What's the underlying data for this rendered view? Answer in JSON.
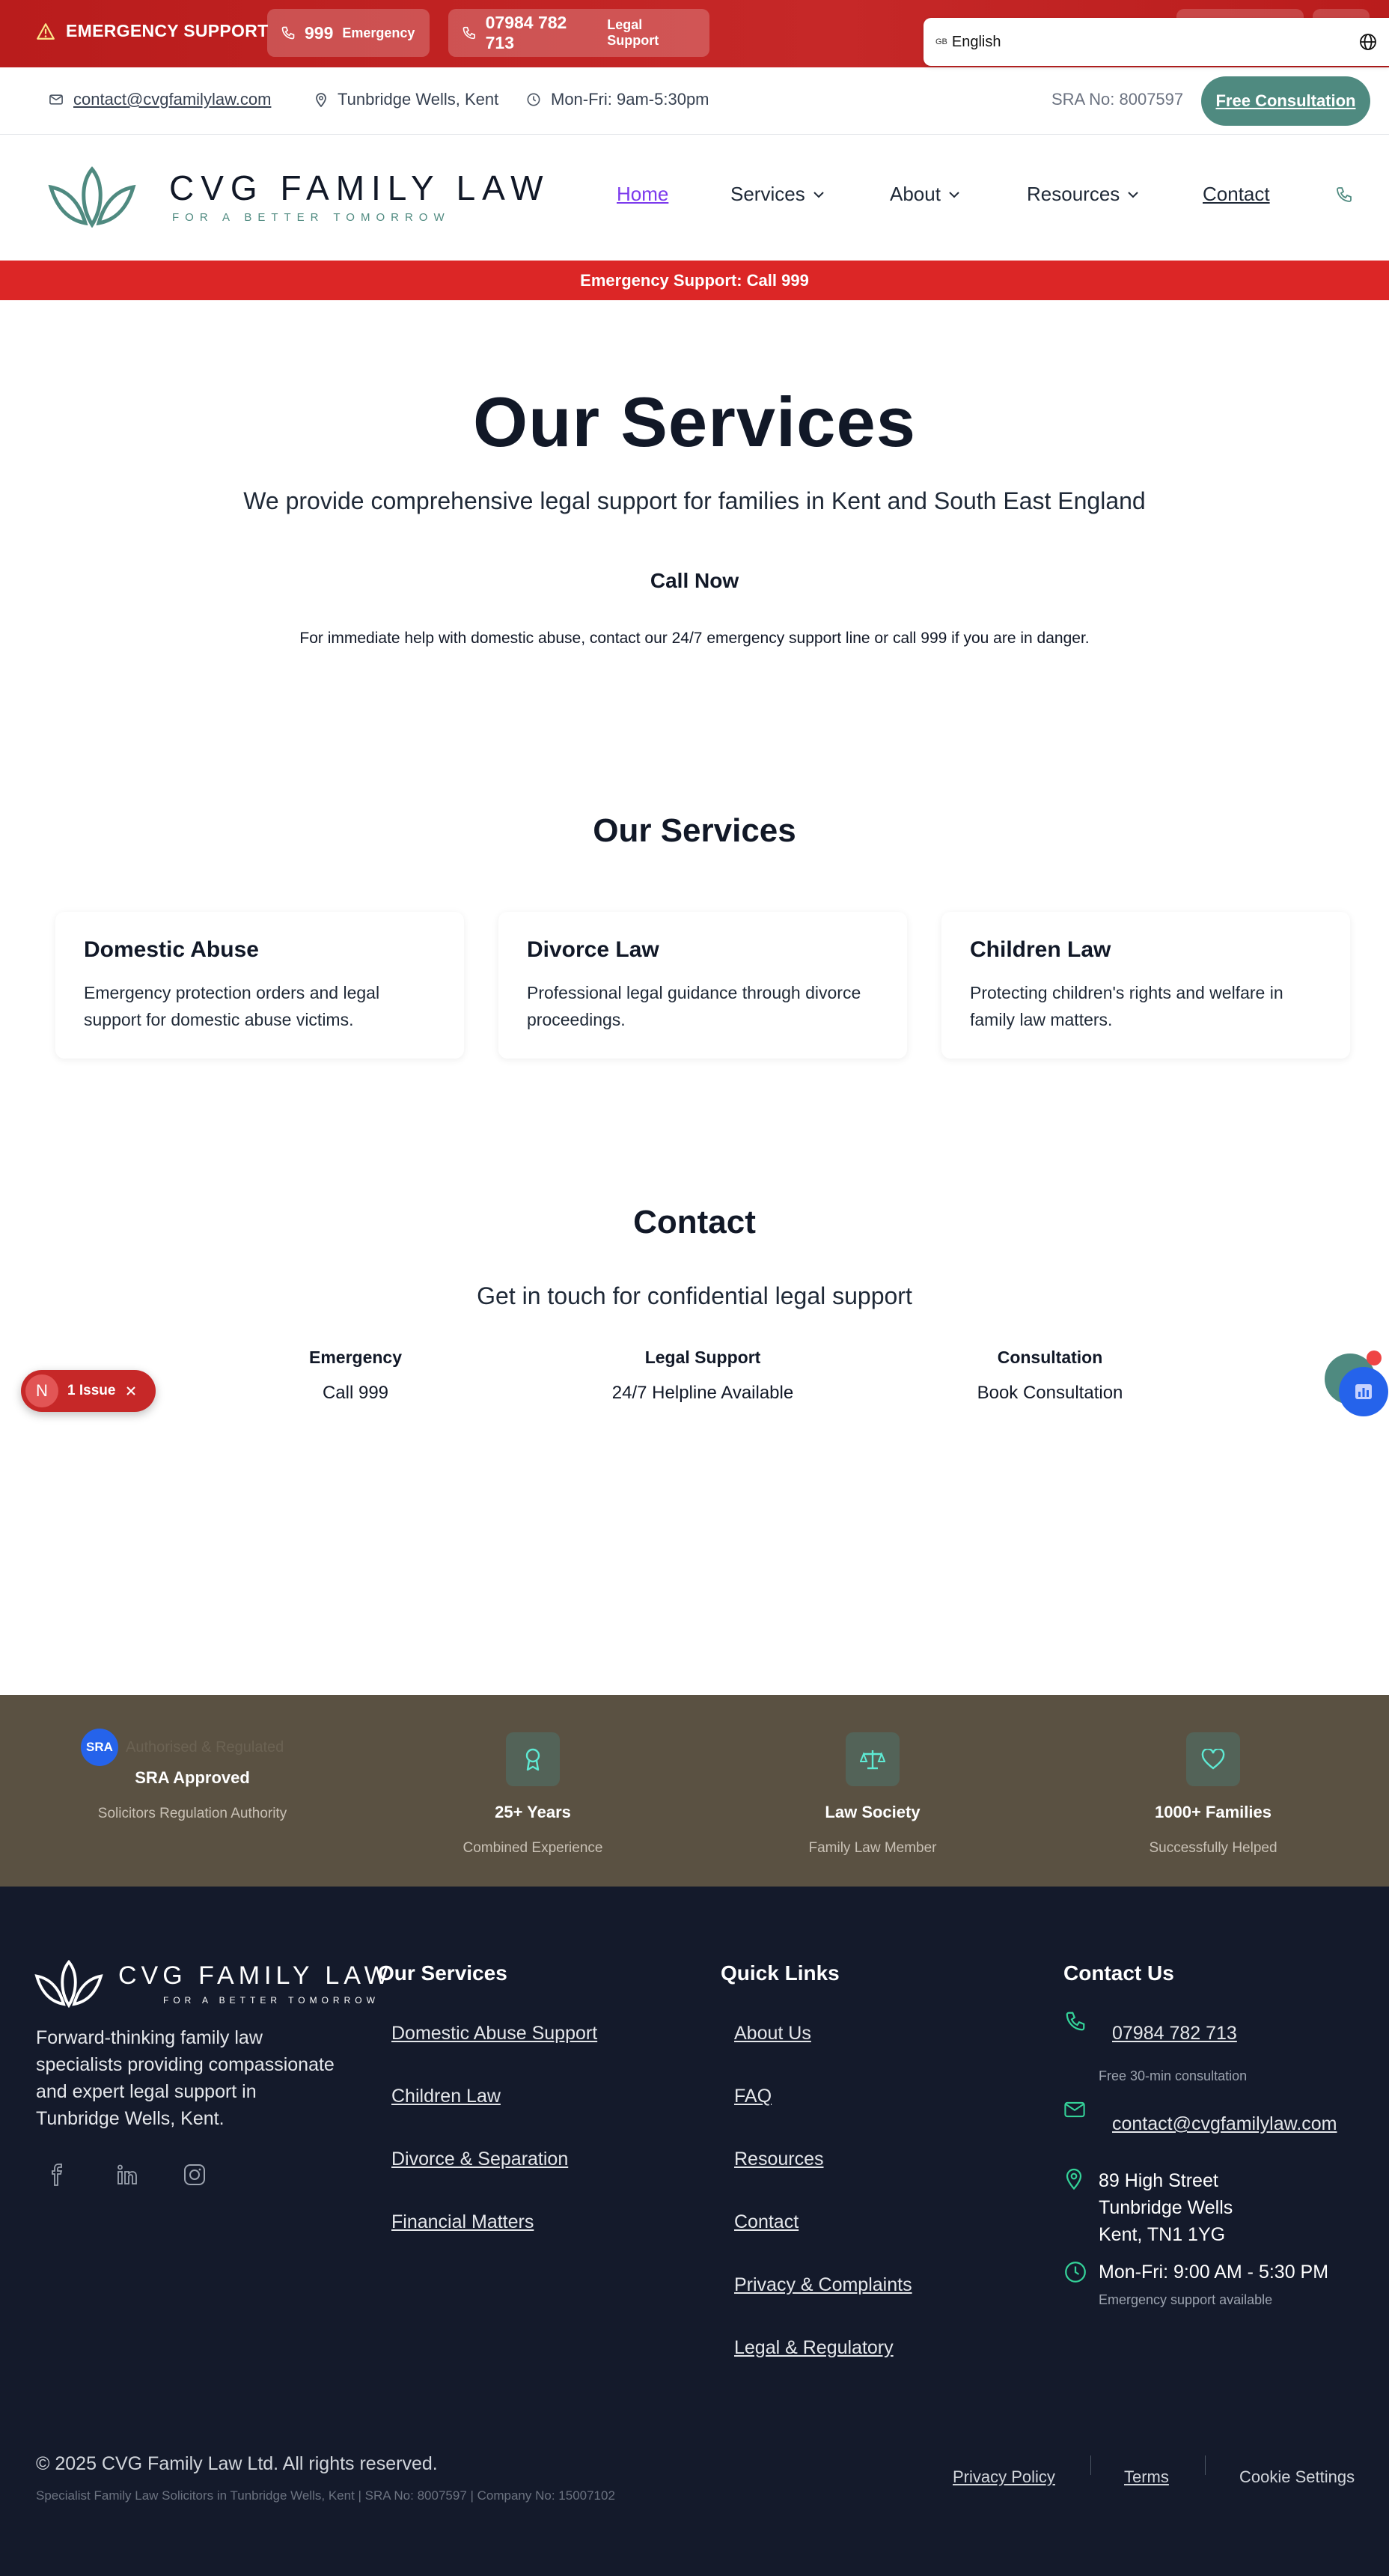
{
  "emergency_bar": {
    "label": "EMERGENCY SUPPORT",
    "phone1_number": "999",
    "phone1_label": "Emergency",
    "phone2_number": "07984 782 713",
    "phone2_label": "Legal Support",
    "language": "English",
    "flag": "GB"
  },
  "info_bar": {
    "email": "contact@cvgfamilylaw.com",
    "location": "Tunbridge Wells, Kent",
    "hours": "Mon-Fri: 9am-5:30pm",
    "sra": "SRA No: 8007597",
    "cta": "Free Consultation"
  },
  "brand": {
    "name": "CVG FAMILY LAW",
    "tagline": "FOR A BETTER TOMORROW"
  },
  "nav": {
    "home": "Home",
    "services": "Services",
    "about": "About",
    "resources": "Resources",
    "contact": "Contact"
  },
  "alert": "Emergency Support: Call 999",
  "hero": {
    "title": "Our Services",
    "subtitle": "We provide comprehensive legal support for families in Kent and South East England",
    "call": "Call Now",
    "note": "For immediate help with domestic abuse, contact our 24/7 emergency support line or call 999 if you are in danger."
  },
  "services": {
    "title": "Our Services",
    "cards": [
      {
        "title": "Domestic Abuse",
        "desc": "Emergency protection orders and legal support for domestic abuse victims."
      },
      {
        "title": "Divorce Law",
        "desc": "Professional legal guidance through divorce proceedings."
      },
      {
        "title": "Children Law",
        "desc": "Protecting children's rights and welfare in family law matters."
      }
    ]
  },
  "contact": {
    "title": "Contact",
    "subtitle": "Get in touch for confidential legal support",
    "cols": [
      {
        "title": "Emergency",
        "value": "Call 999"
      },
      {
        "title": "Legal Support",
        "value": "24/7 Helpline Available"
      },
      {
        "title": "Consultation",
        "value": "Book Consultation"
      }
    ]
  },
  "issue_badge": {
    "letter": "N",
    "label": "1 Issue"
  },
  "trust": {
    "sra_badge": "SRA",
    "sra_caption": "Authorised & Regulated",
    "items": [
      {
        "title": "SRA Approved",
        "sub": "Solicitors Regulation Authority"
      },
      {
        "title": "25+ Years",
        "sub": "Combined Experience"
      },
      {
        "title": "Law Society",
        "sub": "Family Law Member"
      },
      {
        "title": "1000+ Families",
        "sub": "Successfully Helped"
      }
    ]
  },
  "footer": {
    "about": "Forward-thinking family law specialists providing compassionate and expert legal support in Tunbridge Wells, Kent.",
    "services_title": "Our Services",
    "services": [
      "Domestic Abuse Support",
      "Children Law",
      "Divorce & Separation",
      "Financial Matters"
    ],
    "links_title": "Quick Links",
    "links": [
      "About Us",
      "FAQ",
      "Resources",
      "Contact",
      "Privacy & Complaints",
      "Legal & Regulatory"
    ],
    "contact_title": "Contact Us",
    "phone": "07984 782 713",
    "phone_note": "Free 30-min consultation",
    "email": "contact@cvgfamilylaw.com",
    "address1": "89 High Street",
    "address2": "Tunbridge Wells",
    "address3": "Kent, TN1 1YG",
    "hours": "Mon-Fri: 9:00 AM - 5:30 PM",
    "hours_note": "Emergency support available",
    "copyright": "© 2025 CVG Family Law Ltd. All rights reserved.",
    "legal": "Specialist Family Law Solicitors in Tunbridge Wells, Kent | SRA No: 8007597 | Company No: 15007102",
    "privacy": "Privacy Policy",
    "terms": "Terms",
    "cookies": "Cookie Settings"
  },
  "colors": {
    "brand": "#4f8a80",
    "emergency": "#dc2626",
    "footer": "#141a2b",
    "trust": "#5a5142",
    "footer_icon": "#34d399"
  }
}
